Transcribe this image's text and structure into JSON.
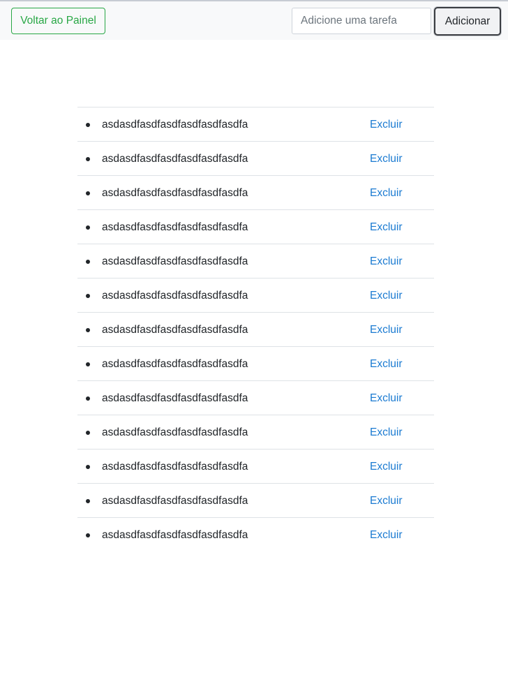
{
  "navbar": {
    "back_label": "Voltar ao Painel",
    "input_placeholder": "Adicione uma tarefa",
    "input_value": "",
    "add_label": "Adicionar"
  },
  "tasks": [
    {
      "text": "asdasdfasdfasdfasdfasdfasdfa",
      "delete_label": "Excluir"
    },
    {
      "text": "asdasdfasdfasdfasdfasdfasdfa",
      "delete_label": "Excluir"
    },
    {
      "text": "asdasdfasdfasdfasdfasdfasdfa",
      "delete_label": "Excluir"
    },
    {
      "text": "asdasdfasdfasdfasdfasdfasdfa",
      "delete_label": "Excluir"
    },
    {
      "text": "asdasdfasdfasdfasdfasdfasdfa",
      "delete_label": "Excluir"
    },
    {
      "text": "asdasdfasdfasdfasdfasdfasdfa",
      "delete_label": "Excluir"
    },
    {
      "text": "asdasdfasdfasdfasdfasdfasdfa",
      "delete_label": "Excluir"
    },
    {
      "text": "asdasdfasdfasdfasdfasdfasdfa",
      "delete_label": "Excluir"
    },
    {
      "text": "asdasdfasdfasdfasdfasdfasdfa",
      "delete_label": "Excluir"
    },
    {
      "text": "asdasdfasdfasdfasdfasdfasdfa",
      "delete_label": "Excluir"
    },
    {
      "text": "asdasdfasdfasdfasdfasdfasdfa",
      "delete_label": "Excluir"
    },
    {
      "text": "asdasdfasdfasdfasdfasdfasdfa",
      "delete_label": "Excluir"
    },
    {
      "text": "asdasdfasdfasdfasdfasdfasdfa",
      "delete_label": "Excluir"
    }
  ],
  "colors": {
    "success": "#28a745",
    "link": "#1a7ad1",
    "navbar_bg": "#f8f9fa",
    "text": "#212529"
  }
}
